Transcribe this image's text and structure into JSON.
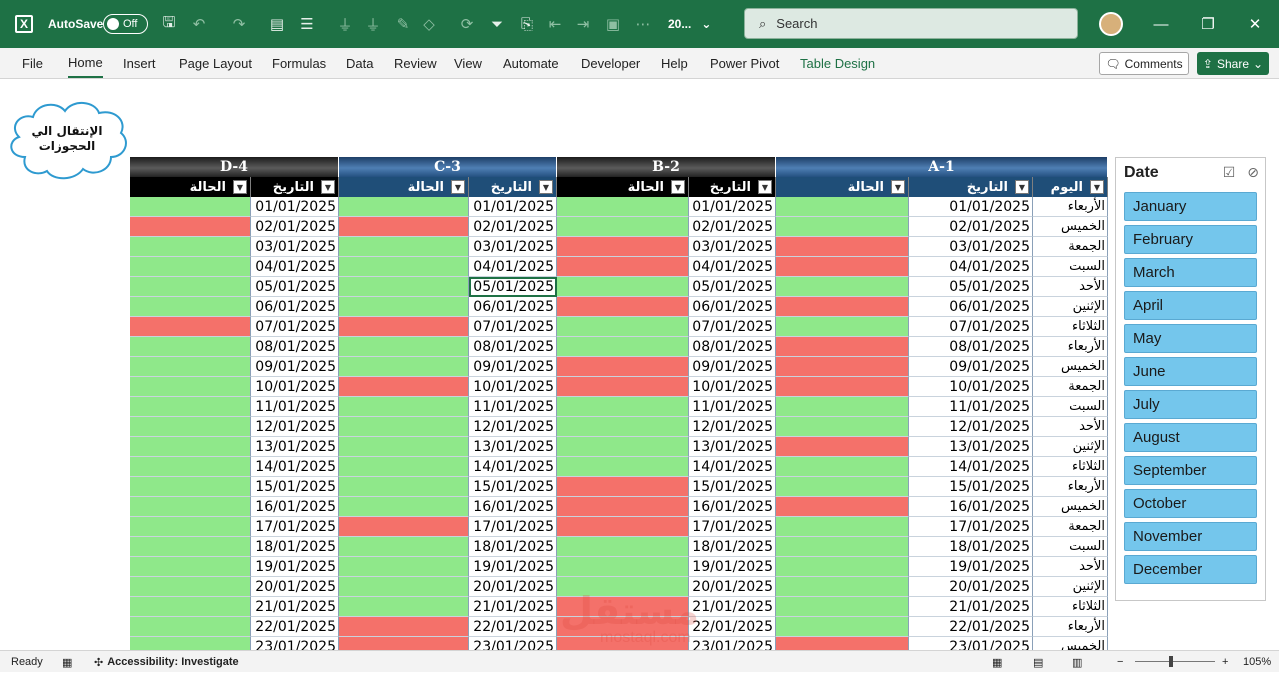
{
  "titlebar": {
    "autosave_label": "AutoSave",
    "autosave_state": "Off",
    "filename": "20...",
    "search_placeholder": "Search",
    "minimize": "—",
    "restore": "❐",
    "close": "✕"
  },
  "ribbon": {
    "tabs": [
      "File",
      "Home",
      "Insert",
      "Page Layout",
      "Formulas",
      "Data",
      "Review",
      "View",
      "Automate",
      "Developer",
      "Help",
      "Power Pivot",
      "Table Design"
    ],
    "active_tab": "Home",
    "comments_label": "Comments",
    "share_label": "Share"
  },
  "cloud_text": "الإنتقال الي الحجوزات",
  "groups": [
    "D-4",
    "C-3",
    "B-2",
    "A-1"
  ],
  "col_headers": {
    "status": "الحالة",
    "date": "التاريخ",
    "day": "اليوم"
  },
  "rows": [
    {
      "date": "01/01/2025",
      "day": "الأربعاء",
      "d4": "g",
      "c3": "g",
      "b2": "g",
      "a1": "g"
    },
    {
      "date": "02/01/2025",
      "day": "الخميس",
      "d4": "r",
      "c3": "r",
      "b2": "g",
      "a1": "g"
    },
    {
      "date": "03/01/2025",
      "day": "الجمعة",
      "d4": "g",
      "c3": "g",
      "b2": "r",
      "a1": "r"
    },
    {
      "date": "04/01/2025",
      "day": "السبت",
      "d4": "g",
      "c3": "g",
      "b2": "r",
      "a1": "r"
    },
    {
      "date": "05/01/2025",
      "day": "الأحد",
      "d4": "g",
      "c3": "g",
      "b2": "g",
      "a1": "g"
    },
    {
      "date": "06/01/2025",
      "day": "الإثنين",
      "d4": "g",
      "c3": "g",
      "b2": "r",
      "a1": "r"
    },
    {
      "date": "07/01/2025",
      "day": "الثلاثاء",
      "d4": "r",
      "c3": "r",
      "b2": "g",
      "a1": "g"
    },
    {
      "date": "08/01/2025",
      "day": "الأربعاء",
      "d4": "g",
      "c3": "g",
      "b2": "g",
      "a1": "r"
    },
    {
      "date": "09/01/2025",
      "day": "الخميس",
      "d4": "g",
      "c3": "g",
      "b2": "r",
      "a1": "r"
    },
    {
      "date": "10/01/2025",
      "day": "الجمعة",
      "d4": "g",
      "c3": "r",
      "b2": "r",
      "a1": "r"
    },
    {
      "date": "11/01/2025",
      "day": "السبت",
      "d4": "g",
      "c3": "g",
      "b2": "g",
      "a1": "g"
    },
    {
      "date": "12/01/2025",
      "day": "الأحد",
      "d4": "g",
      "c3": "g",
      "b2": "g",
      "a1": "g"
    },
    {
      "date": "13/01/2025",
      "day": "الإثنين",
      "d4": "g",
      "c3": "g",
      "b2": "g",
      "a1": "r"
    },
    {
      "date": "14/01/2025",
      "day": "الثلاثاء",
      "d4": "g",
      "c3": "g",
      "b2": "g",
      "a1": "g"
    },
    {
      "date": "15/01/2025",
      "day": "الأربعاء",
      "d4": "g",
      "c3": "g",
      "b2": "r",
      "a1": "g"
    },
    {
      "date": "16/01/2025",
      "day": "الخميس",
      "d4": "g",
      "c3": "g",
      "b2": "r",
      "a1": "r"
    },
    {
      "date": "17/01/2025",
      "day": "الجمعة",
      "d4": "g",
      "c3": "r",
      "b2": "r",
      "a1": "g"
    },
    {
      "date": "18/01/2025",
      "day": "السبت",
      "d4": "g",
      "c3": "g",
      "b2": "g",
      "a1": "g"
    },
    {
      "date": "19/01/2025",
      "day": "الأحد",
      "d4": "g",
      "c3": "g",
      "b2": "g",
      "a1": "g"
    },
    {
      "date": "20/01/2025",
      "day": "الإثنين",
      "d4": "g",
      "c3": "g",
      "b2": "g",
      "a1": "g"
    },
    {
      "date": "21/01/2025",
      "day": "الثلاثاء",
      "d4": "g",
      "c3": "g",
      "b2": "r",
      "a1": "g"
    },
    {
      "date": "22/01/2025",
      "day": "الأربعاء",
      "d4": "g",
      "c3": "r",
      "b2": "r",
      "a1": "g"
    },
    {
      "date": "23/01/2025",
      "day": "الخميس",
      "d4": "g",
      "c3": "r",
      "b2": "r",
      "a1": "r"
    }
  ],
  "slicer": {
    "title": "Date",
    "items": [
      "January",
      "February",
      "March",
      "April",
      "May",
      "June",
      "July",
      "August",
      "September",
      "October",
      "November",
      "December"
    ]
  },
  "statusbar": {
    "ready": "Ready",
    "accessibility": "Accessibility: Investigate",
    "zoom": "105%"
  },
  "watermark": {
    "text": "مستقل",
    "sub": "mostaql.com"
  },
  "colors": {
    "excel_green": "#1e7145",
    "status_green": "#8fe88a",
    "status_red": "#f4716a",
    "slicer_blue": "#74c6ec"
  }
}
